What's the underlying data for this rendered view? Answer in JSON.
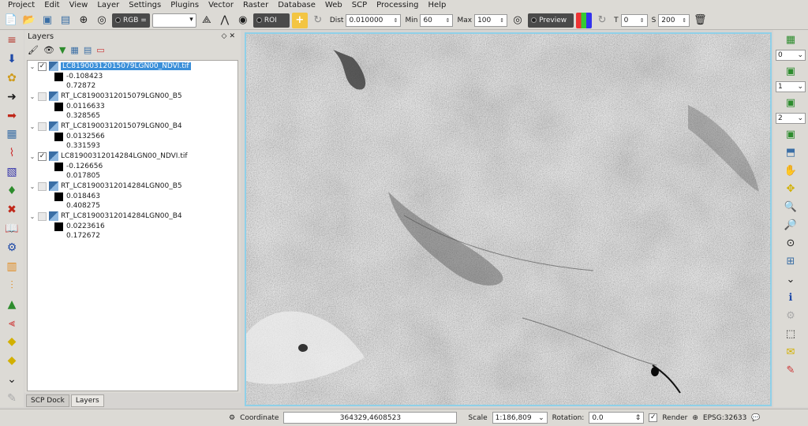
{
  "menu": [
    "Project",
    "Edit",
    "View",
    "Layer",
    "Settings",
    "Plugins",
    "Vector",
    "Raster",
    "Database",
    "Web",
    "SCP",
    "Processing",
    "Help"
  ],
  "toolbar": {
    "rgb_label": "RGB =",
    "roi_label": "ROI",
    "dist_label": "Dist",
    "dist_value": "0.010000",
    "min_label": "Min",
    "min_value": "60",
    "max_label": "Max",
    "max_value": "100",
    "preview_label": "Preview",
    "t_label": "T",
    "t_value": "0",
    "s_label": "S",
    "s_value": "200"
  },
  "layers_panel": {
    "title": "Layers",
    "layers": [
      {
        "name": "LC81900312015079LGN00_NDVI.tif",
        "checked": true,
        "selected": true,
        "min": "-0.108423",
        "max": "0.72872"
      },
      {
        "name": "RT_LC81900312015079LGN00_B5",
        "checked": false,
        "selected": false,
        "min": "0.0116633",
        "max": "0.328565"
      },
      {
        "name": "RT_LC81900312015079LGN00_B4",
        "checked": false,
        "selected": false,
        "min": "0.0132566",
        "max": "0.331593"
      },
      {
        "name": "LC81900312014284LGN00_NDVI.tif",
        "checked": true,
        "selected": false,
        "min": "-0.126656",
        "max": "0.017805"
      },
      {
        "name": "RT_LC81900312014284LGN00_B5",
        "checked": false,
        "selected": false,
        "min": "0.018463",
        "max": "0.408275"
      },
      {
        "name": "RT_LC81900312014284LGN00_B4",
        "checked": false,
        "selected": false,
        "min": "0.0223616",
        "max": "0.172672"
      }
    ],
    "tabs": [
      "SCP Dock",
      "Layers"
    ]
  },
  "right_tools": {
    "spin1": "0",
    "spin2": "1",
    "spin3": "2"
  },
  "statusbar": {
    "coordinate_label": "Coordinate",
    "coordinate_value": "364329,4608523",
    "scale_label": "Scale",
    "scale_value": "1:186,809",
    "rotation_label": "Rotation:",
    "rotation_value": "0.0",
    "render_label": "Render",
    "crs_label": "EPSG:32633"
  }
}
